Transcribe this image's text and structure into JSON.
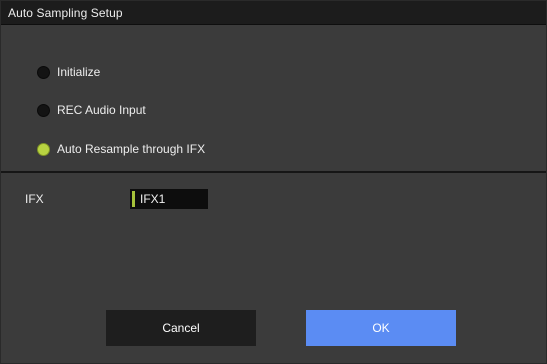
{
  "dialog": {
    "title": "Auto Sampling Setup"
  },
  "options": [
    {
      "label": "Initialize",
      "selected": false
    },
    {
      "label": "REC Audio Input",
      "selected": false
    },
    {
      "label": "Auto Resample through IFX",
      "selected": true
    }
  ],
  "ifx": {
    "label": "IFX",
    "value": "IFX1"
  },
  "buttons": {
    "cancel": "Cancel",
    "ok": "OK"
  },
  "colors": {
    "background": "#3b3b3b",
    "title_bar": "#1c1c1c",
    "radio_selected": "#b8d341",
    "ok_button": "#5b8cf3",
    "cancel_button": "#1e1e1e"
  }
}
